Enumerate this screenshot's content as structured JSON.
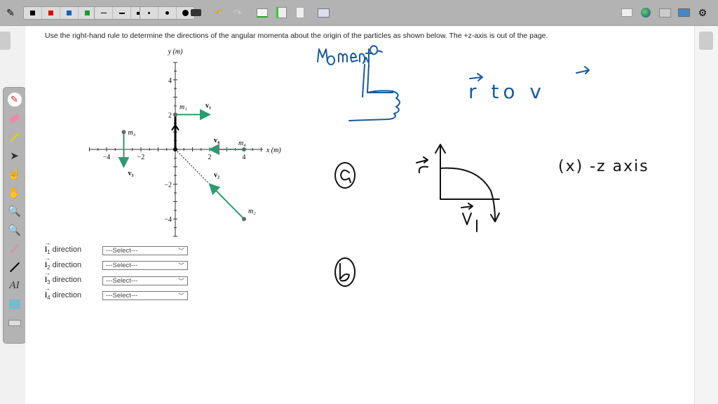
{
  "toolbar": {
    "colors": [
      "#000000",
      "#e00000",
      "#1a5fb4",
      "#1c9a2c",
      "#f2d600"
    ],
    "left_icons": [
      "pen-tool-icon",
      "keyboard-icon",
      "undo-icon",
      "redo-icon",
      "add-page-icon",
      "page-green-icon",
      "page-blank-icon",
      "settings-page-icon"
    ],
    "right_icons": [
      "whiteboard-icon",
      "globe-icon",
      "folder-icon",
      "monitor-icon",
      "gear-icon"
    ]
  },
  "left_tools": [
    "pen-icon",
    "eraser-icon",
    "highlighter-icon",
    "pointer-icon",
    "hand-select-icon",
    "hand-pan-icon",
    "zoom-in-icon",
    "zoom-out-icon",
    "laser-pointer-icon",
    "line-icon",
    "text-icon",
    "image-icon",
    "keyboard-icon"
  ],
  "question": "Use the right-hand rule to determine the directions of the angular momenta about the origin of the particles as shown below. The +z-axis is out of the page.",
  "chart": {
    "ylabel": "y (m)",
    "xlabel": "x (m)",
    "xticks": [
      "−4",
      "−2",
      "2",
      "4"
    ],
    "yticks": [
      "4",
      "2",
      "−2",
      "−4"
    ],
    "particles": [
      {
        "mass": "m1",
        "velocity": "v1",
        "pos": [
          0,
          2
        ],
        "vel": [
          2,
          0
        ]
      },
      {
        "mass": "m2",
        "velocity": "v2",
        "pos": [
          4,
          -4
        ],
        "vel": [
          -2,
          2
        ]
      },
      {
        "mass": "m3",
        "velocity": "v3",
        "pos": [
          -3,
          1
        ],
        "vel": [
          0,
          -2
        ]
      },
      {
        "mass": "m4",
        "velocity": "v4",
        "pos": [
          4,
          0
        ],
        "vel": [
          -2,
          0
        ]
      }
    ],
    "arrow_color": "#2e9a6e"
  },
  "directions": [
    {
      "sym": "l",
      "sub": "1",
      "label": "direction",
      "value": "---Select---"
    },
    {
      "sym": "l",
      "sub": "2",
      "label": "direction",
      "value": "---Select---"
    },
    {
      "sym": "l",
      "sub": "3",
      "label": "direction",
      "value": "---Select---"
    },
    {
      "sym": "l",
      "sub": "4",
      "label": "direction",
      "value": "---Select---"
    }
  ],
  "notes": {
    "momenta": "Momenta",
    "r_to_v": "r to v",
    "a": "a",
    "b": "b",
    "axis": "(x) -z axis",
    "r": "r",
    "v1": "v1"
  }
}
